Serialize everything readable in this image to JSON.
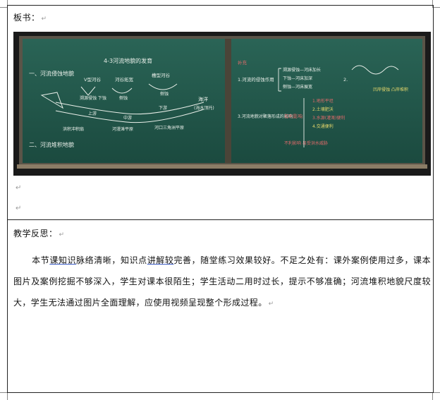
{
  "board_section": {
    "label": "板书：",
    "para_mark": "↵"
  },
  "blackboard": {
    "left_title": "4-3河流地貌的发育",
    "left_headings": [
      "一、河流侵蚀地貌",
      "二、河流堆积地貌"
    ],
    "left_notes": [
      "V型河谷",
      "河谷拓宽",
      "槽型河谷",
      "溯源侵蚀 下蚀",
      "侧蚀",
      "侧蚀",
      "上游",
      "中游",
      "下游",
      "海洋",
      "(海水顶托)",
      "洪积冲积扇",
      "河漫滩平原",
      "河口三角洲平原"
    ],
    "right_notes": [
      "补充",
      "1.河流的侵蚀作用",
      "溯源侵蚀—河床加长",
      "下蚀—河床加深",
      "侧蚀—河床展宽",
      "2.",
      "凹岸侵蚀 凸岸堆积",
      "3.河流地貌对聚落形成的影响",
      "有利影响",
      "1.地形平坦",
      "2.土壤肥沃",
      "3.水源(灌溉)便利",
      "4.交通便利",
      "不利影响 易受洪水威胁"
    ]
  },
  "reflection": {
    "label": "教学反思：",
    "line1_a": "本节",
    "line1_u1": "课知识",
    "line1_b": "脉络清晰，知识点",
    "line1_u2": "讲解较",
    "line1_c": "完善，随堂练习效果较好。不足之处有：课外案例使用过多，课本图片及案例挖掘不够深入，学生对课本很陌生；学生活动二用时过长，提示不够准确；河流堆积地貌尺度较大，学生无法通过图片全面理解，应使用视频呈现整个形成过程。"
  },
  "colors": {
    "board_green": "#1f5448",
    "chalk_white": "#e9efe9",
    "chalk_red": "#e06a6a",
    "chalk_yellow": "#e8d96b"
  }
}
